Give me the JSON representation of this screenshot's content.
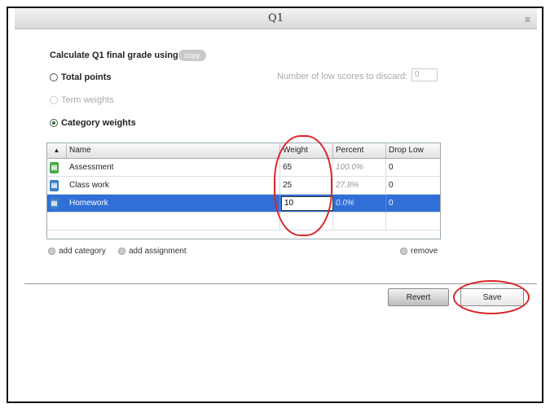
{
  "window": {
    "title": "Q1"
  },
  "calc": {
    "label": "Calculate Q1 final grade using:",
    "copy_label": "copy"
  },
  "options": {
    "total_points": "Total points",
    "term_weights": "Term weights",
    "category_weights": "Category weights",
    "selected": "category_weights"
  },
  "low_scores": {
    "label": "Number of low scores to discard:",
    "value": "0"
  },
  "table": {
    "sort_indicator": "▲",
    "columns": [
      "Name",
      "Weight",
      "Percent",
      "Drop Low"
    ],
    "rows": [
      {
        "name": "Assessment",
        "weight": "65",
        "percent": "100.0%",
        "drop_low": "0",
        "icon": "green-category-icon"
      },
      {
        "name": "Class work",
        "weight": "25",
        "percent": "27.8%",
        "drop_low": "0",
        "icon": "blue-category-icon"
      },
      {
        "name": "Homework",
        "weight": "10",
        "percent": "0.0%",
        "drop_low": "0",
        "icon": "blue-category-icon",
        "selected": true
      }
    ]
  },
  "actions": {
    "add_category": "add category",
    "add_assignment": "add assignment",
    "remove": "remove"
  },
  "buttons": {
    "revert": "Revert",
    "save": "Save"
  },
  "colors": {
    "selection": "#2f6fd6",
    "annotation": "#d9262b"
  }
}
